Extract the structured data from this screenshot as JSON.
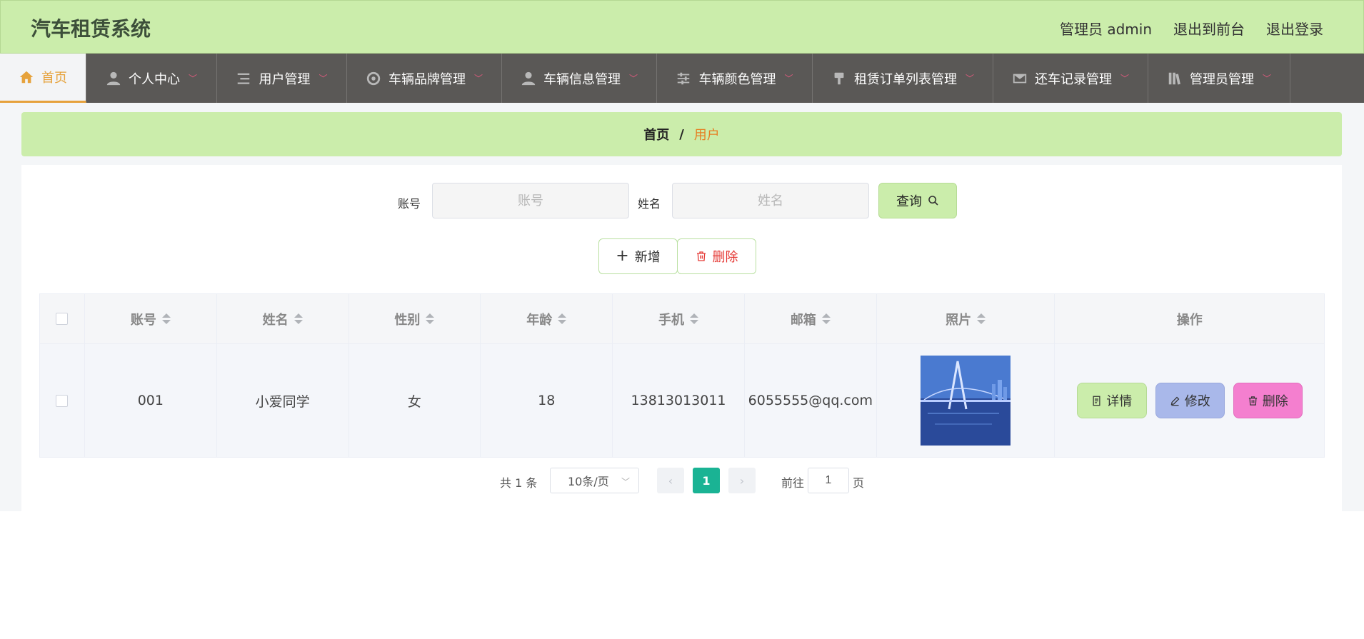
{
  "header": {
    "title": "汽车租赁系统",
    "links": [
      "管理员 admin",
      "退出到前台",
      "退出登录"
    ]
  },
  "nav": {
    "items": [
      {
        "label": "首页",
        "icon": "home-icon",
        "active": true
      },
      {
        "label": "个人中心",
        "icon": "user-icon"
      },
      {
        "label": "用户管理",
        "icon": "list-icon"
      },
      {
        "label": "车辆品牌管理",
        "icon": "circle-icon"
      },
      {
        "label": "车辆信息管理",
        "icon": "user-icon"
      },
      {
        "label": "车辆颜色管理",
        "icon": "sliders-icon"
      },
      {
        "label": "租赁订单列表管理",
        "icon": "brush-icon"
      },
      {
        "label": "还车记录管理",
        "icon": "mail-icon"
      },
      {
        "label": "管理员管理",
        "icon": "books-icon"
      }
    ]
  },
  "breadcrumb": {
    "home": "首页",
    "separator": "/",
    "current": "用户"
  },
  "search": {
    "account_label": "账号",
    "account_placeholder": "账号",
    "name_label": "姓名",
    "name_placeholder": "姓名",
    "query_label": "查询"
  },
  "actions": {
    "add_label": "新增",
    "delete_label": "删除"
  },
  "table": {
    "headers": [
      "账号",
      "姓名",
      "性别",
      "年龄",
      "手机",
      "邮箱",
      "照片",
      "操作"
    ],
    "rows": [
      {
        "account": "001",
        "name": "小爱同学",
        "gender": "女",
        "age": "18",
        "phone": "13813013011",
        "email": "6055555@qq.com"
      }
    ],
    "row_actions": {
      "detail": "详情",
      "edit": "修改",
      "delete": "删除"
    }
  },
  "pagination": {
    "total_text": "共 1 条",
    "page_size": "10条/页",
    "current_page": "1",
    "goto_label": "前往",
    "goto_value": "1",
    "page_suffix": "页"
  },
  "colors": {
    "header_bg": "#cbedab",
    "nav_bg": "#5a5856",
    "active_accent": "#e6a23c",
    "page_active": "#1ab394"
  }
}
